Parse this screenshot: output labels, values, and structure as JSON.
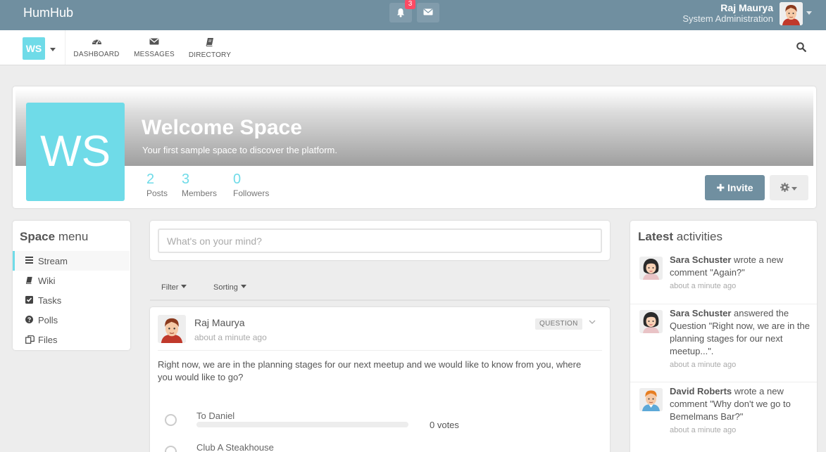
{
  "topbar": {
    "brand": "HumHub",
    "notification_count": "3",
    "user_name": "Raj Maurya",
    "user_role": "System Administration"
  },
  "nav": {
    "space_initials": "WS",
    "items": [
      {
        "label": "DASHBOARD"
      },
      {
        "label": "MESSAGES"
      },
      {
        "label": "DIRECTORY"
      }
    ]
  },
  "space": {
    "initials": "WS",
    "title": "Welcome Space",
    "subtitle": "Your first sample space to discover the platform.",
    "stats": [
      {
        "num": "2",
        "label": "Posts"
      },
      {
        "num": "3",
        "label": "Members"
      },
      {
        "num": "0",
        "label": "Followers"
      }
    ],
    "invite_label": "Invite"
  },
  "menu": {
    "title_bold": "Space",
    "title_rest": " menu",
    "items": [
      {
        "label": "Stream",
        "icon": "list-icon"
      },
      {
        "label": "Wiki",
        "icon": "book-icon"
      },
      {
        "label": "Tasks",
        "icon": "checkbox-icon"
      },
      {
        "label": "Polls",
        "icon": "question-circle-icon"
      },
      {
        "label": "Files",
        "icon": "files-icon"
      }
    ]
  },
  "composer": {
    "placeholder": "What's on your mind?"
  },
  "filters": {
    "filter_label": "Filter",
    "sorting_label": "Sorting"
  },
  "entry": {
    "author": "Raj Maurya",
    "time": "about a minute ago",
    "label": "QUESTION",
    "text": "Right now, we are in the planning stages for our next meetup and we would like to know from you, where you would like to go?",
    "options": [
      {
        "label": "To Daniel",
        "votes": "0 votes",
        "fraction": 0
      },
      {
        "label": "Club A Steakhouse",
        "votes": "",
        "fraction": 0
      }
    ]
  },
  "activities": {
    "title_bold": "Latest",
    "title_rest": " activities",
    "items": [
      {
        "user": "Sara Schuster",
        "text": " wrote a new comment \"Again?\"",
        "time": "about a minute ago"
      },
      {
        "user": "Sara Schuster",
        "text": " answered the Question \"Right now, we are in the planning stages for our next meetup...\".",
        "time": "about a minute ago"
      },
      {
        "user": "David Roberts",
        "text": " wrote a new comment \"Why don't we go to Bemelmans Bar?\"",
        "time": "about a minute ago"
      }
    ]
  },
  "colors": {
    "primary": "#708fa0",
    "accent": "#6fdbe8",
    "badge": "#fc4a64"
  }
}
